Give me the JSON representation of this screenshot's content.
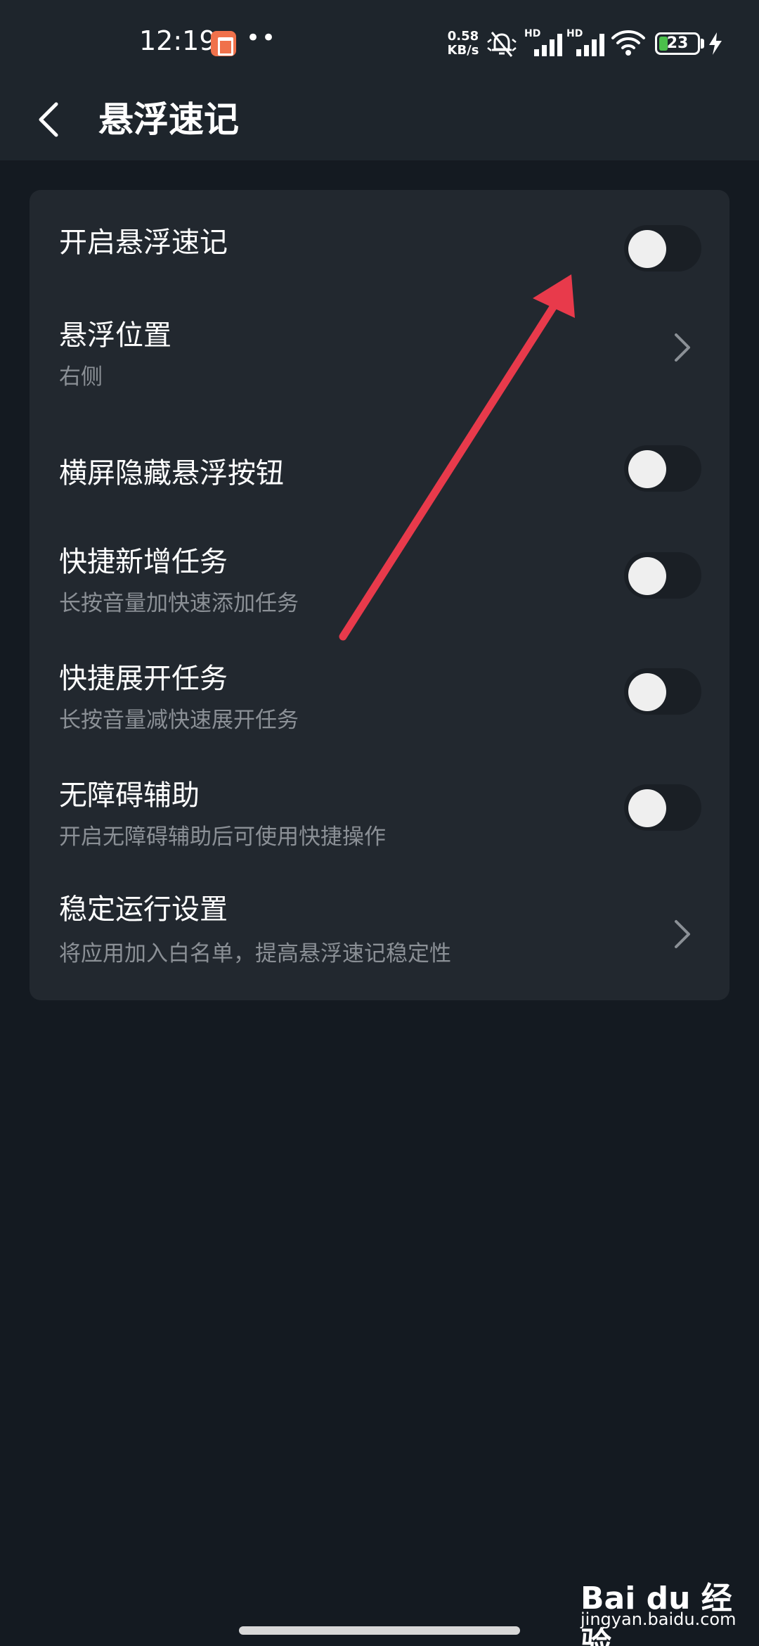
{
  "status_bar": {
    "time": "12:19",
    "dots": "••",
    "net_speed_value": "0.58",
    "net_speed_unit": "KB/s",
    "hd_label": "HD",
    "battery_level": "23",
    "battery_fraction": 0.23,
    "battery_color": "#4bc04b",
    "app_icon_color": "#f0714b"
  },
  "app_bar": {
    "back_icon": "chevron-left-icon",
    "title": "悬浮速记"
  },
  "settings": {
    "items": [
      {
        "title": "开启悬浮速记",
        "subtitle": "",
        "control": "toggle",
        "on": false
      },
      {
        "title": "悬浮位置",
        "subtitle": "右侧",
        "control": "chevron"
      },
      {
        "title": "横屏隐藏悬浮按钮",
        "subtitle": "",
        "control": "toggle",
        "on": false
      },
      {
        "title": "快捷新增任务",
        "subtitle": "长按音量加快速添加任务",
        "control": "toggle",
        "on": false
      },
      {
        "title": "快捷展开任务",
        "subtitle": "长按音量减快速展开任务",
        "control": "toggle",
        "on": false
      },
      {
        "title": "无障碍辅助",
        "subtitle": "开启无障碍辅助后可使用快捷操作",
        "control": "toggle",
        "on": false
      },
      {
        "title": "稳定运行设置",
        "subtitle": "将应用加入白名单，提高悬浮速记稳定性",
        "control": "chevron"
      }
    ]
  },
  "annotation": {
    "arrow_color": "#e83a4b"
  },
  "watermark": {
    "logo": "Bai du 经验",
    "url": "jingyan.baidu.com"
  },
  "colors": {
    "background": "#141a21",
    "top_bar": "#1e252c",
    "card": "#22282f",
    "subtitle_text": "#8b9096",
    "toggle_track_off": "#1a1f25"
  }
}
